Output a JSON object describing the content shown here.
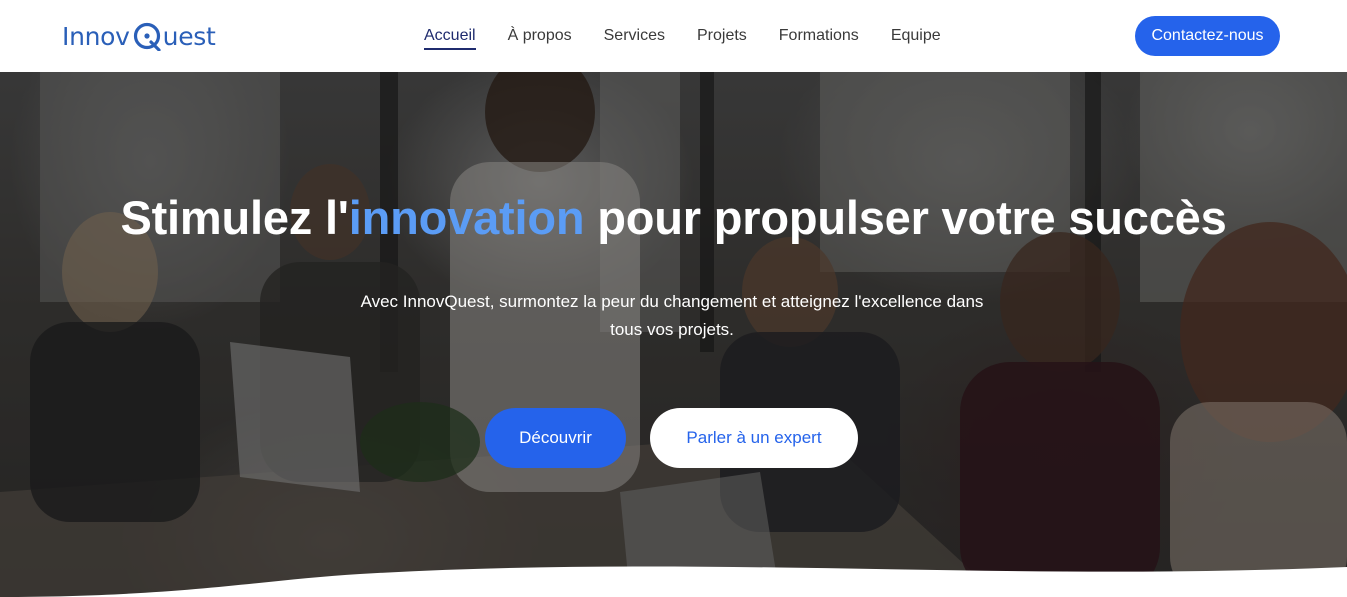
{
  "brand": {
    "name_part1": "Innov",
    "name_part2": "uest",
    "logo_letter": "Q",
    "color": "#2a5fb8"
  },
  "nav": {
    "items": [
      {
        "label": "Accueil",
        "active": true
      },
      {
        "label": "À propos",
        "active": false
      },
      {
        "label": "Services",
        "active": false
      },
      {
        "label": "Projets",
        "active": false
      },
      {
        "label": "Formations",
        "active": false
      },
      {
        "label": "Equipe",
        "active": false
      }
    ],
    "cta_label": "Contactez-nous"
  },
  "hero": {
    "title_before": "Stimulez l'",
    "title_accent": "innovation",
    "title_after": " pour propulser votre succès",
    "subtitle_line1": "Avec InnovQuest, surmontez la peur du changement et atteignez l'excellence dans",
    "subtitle_line2": "tous vos projets.",
    "primary_button": "Découvrir",
    "secondary_button": "Parler à un expert",
    "background_image": "office-team-meeting-photo"
  },
  "colors": {
    "accent": "#2563eb",
    "title_highlight": "#5b9cf5",
    "active_nav": "#1f2b6e"
  }
}
